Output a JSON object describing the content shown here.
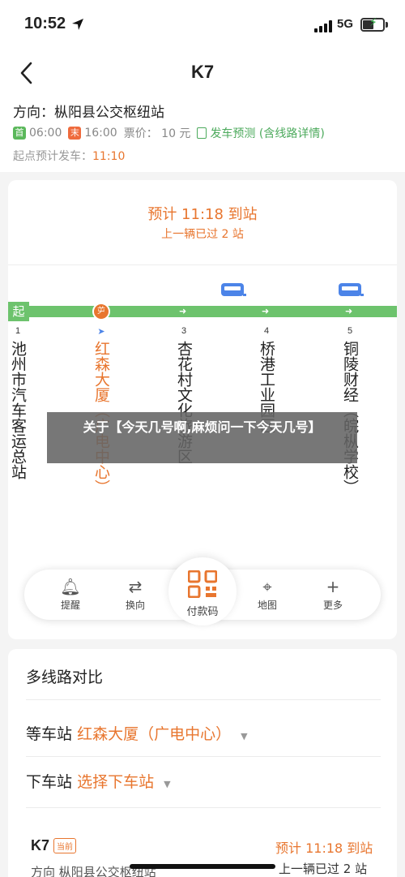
{
  "status_bar": {
    "time": "10:52",
    "network": "5G"
  },
  "header": {
    "title": "K7",
    "direction_label": "方向：",
    "direction_value": "枞阳县公交枢纽站",
    "first_badge": "首",
    "first_time": "06:00",
    "last_badge": "末",
    "last_time": "16:00",
    "fare": "票价： 10 元",
    "predict_link": "发车预测 (含线路详情)",
    "start_label": "起点预计发车：",
    "start_time": "11:10"
  },
  "route": {
    "eta": "预计 11:18 到站",
    "prev_bus": "上一辆已过 2 站",
    "start_marker": "起",
    "current_marker": "屰",
    "stops": [
      {
        "num": "1",
        "name": "池州市汽车客运总站"
      },
      {
        "num": "",
        "name": "红森大厦（广电中心）"
      },
      {
        "num": "3",
        "name": "杏花村文化旅游区"
      },
      {
        "num": "4",
        "name": "桥港工业园区"
      },
      {
        "num": "5",
        "name": "铜陵财经（皖枞学校）"
      }
    ]
  },
  "actions": {
    "remind": "提醒",
    "reverse": "换向",
    "pay": "付款码",
    "map": "地图",
    "more": "更多"
  },
  "overlay": {
    "text": "关于【今天几号啊,麻烦问一下今天几号】"
  },
  "compare": {
    "title": "多线路对比",
    "wait_label": "等车站",
    "wait_value": "红森大厦（广电中心）",
    "alight_label": "下车站",
    "alight_value": "选择下车站",
    "route_name": "K7",
    "current_tag": "当前",
    "route_eta": "预计 11:18 到站",
    "route_direction": "方向  枞阳县公交枢纽站",
    "route_prev": "上一辆已过 2 站"
  },
  "colors": {
    "accent": "#e8762f",
    "line": "#6dc36d",
    "bus": "#4c84e8"
  }
}
